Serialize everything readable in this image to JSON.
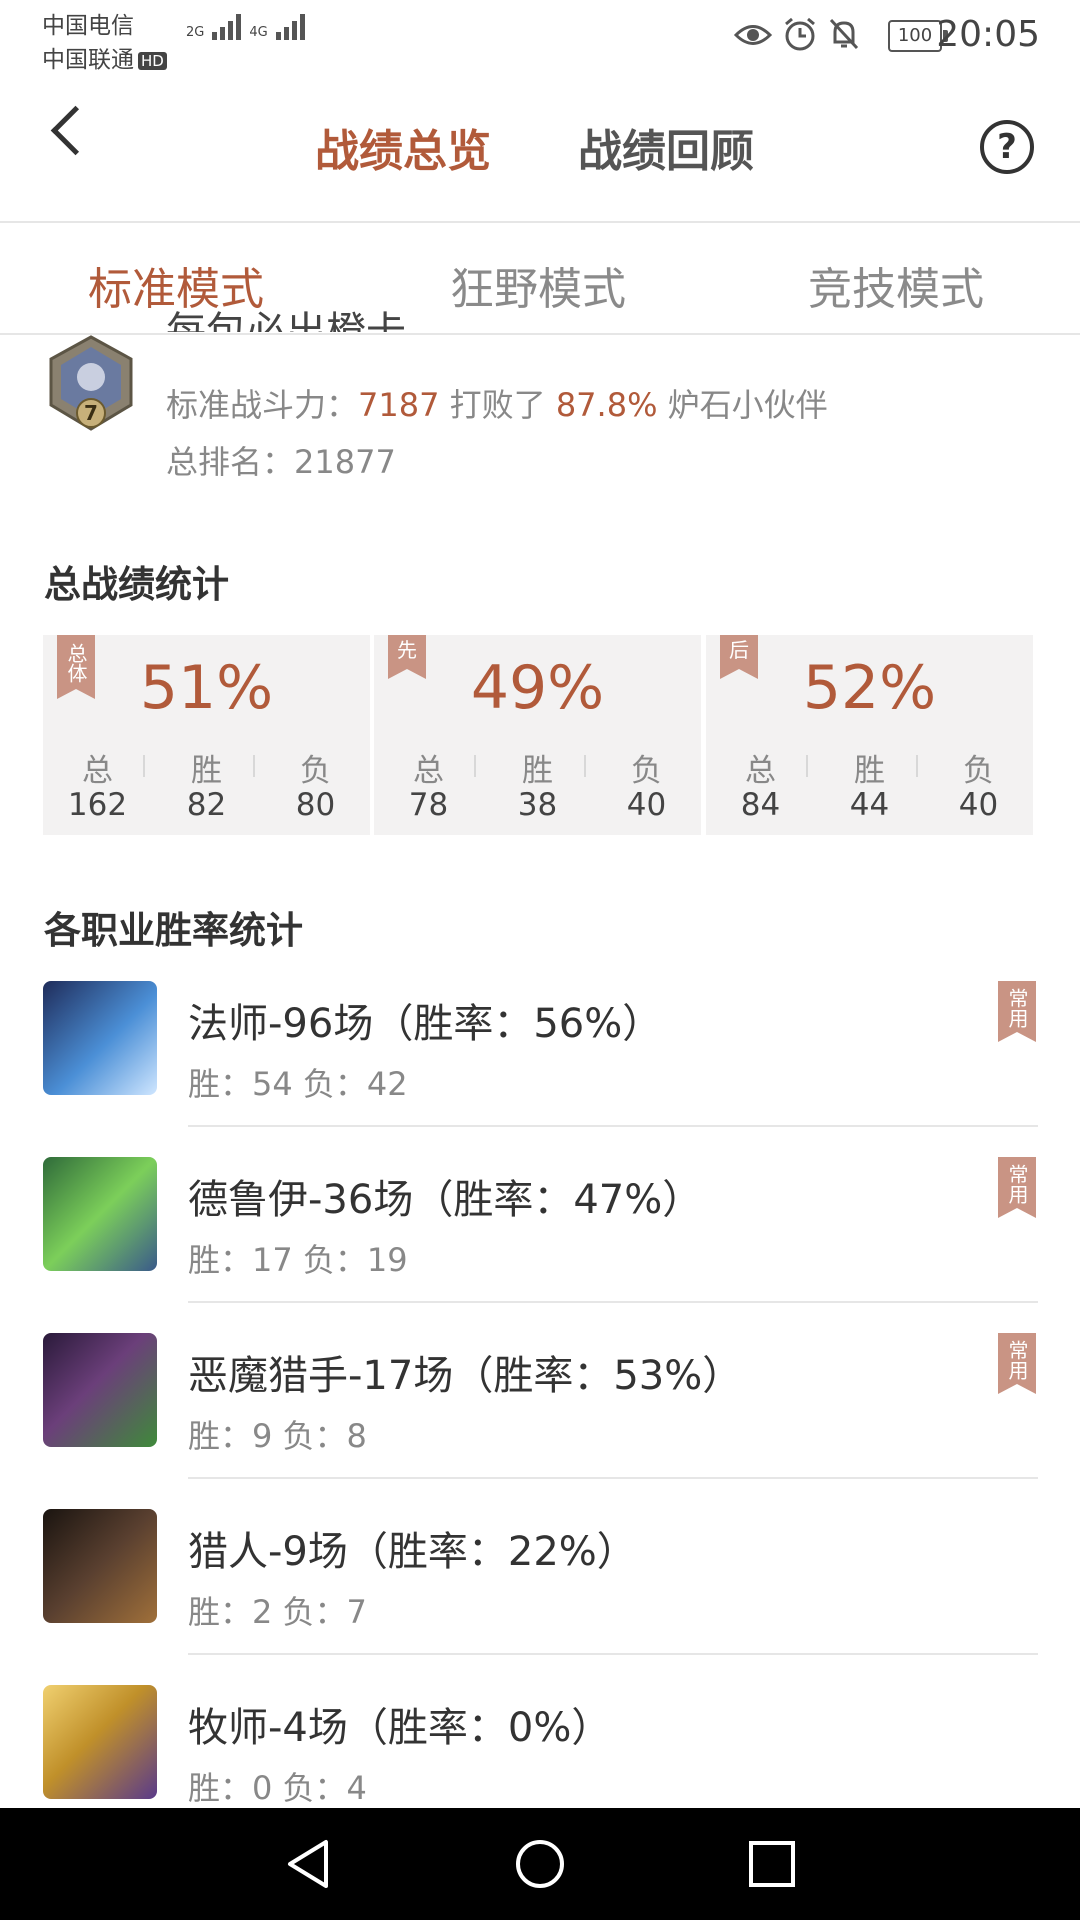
{
  "status_bar": {
    "carrier1": "中国电信",
    "carrier2": "中国联通",
    "hd": "HD",
    "net1": "2G",
    "net2": "4G",
    "battery": "100",
    "time": "20:05"
  },
  "header": {
    "tabs": [
      {
        "label": "战绩总览",
        "active": true
      },
      {
        "label": "战绩回顾",
        "active": false
      }
    ],
    "help": "?"
  },
  "modes": [
    {
      "label": "标准模式",
      "active": true
    },
    {
      "label": "狂野模式",
      "active": false
    },
    {
      "label": "竞技模式",
      "active": false
    }
  ],
  "profile": {
    "name_fragment": "每包必出橙卡",
    "rank_level": "7",
    "power_label": "标准战斗力：",
    "power_value": "7187",
    "beat_label": " 打败了 ",
    "beat_pct": "87.8%",
    "beat_suffix": " 炉石小伙伴",
    "rank_label": "总排名：",
    "rank_value": "21877"
  },
  "summary": {
    "title": "总战绩统计",
    "cards": [
      {
        "tag": "总体",
        "pct": "51%",
        "total_label": "总",
        "win_label": "胜",
        "loss_label": "负",
        "total": "162",
        "win": "82",
        "loss": "80"
      },
      {
        "tag": "先",
        "pct": "49%",
        "total_label": "总",
        "win_label": "胜",
        "loss_label": "负",
        "total": "78",
        "win": "38",
        "loss": "40"
      },
      {
        "tag": "后",
        "pct": "52%",
        "total_label": "总",
        "win_label": "胜",
        "loss_label": "负",
        "total": "84",
        "win": "44",
        "loss": "40"
      }
    ]
  },
  "classes": {
    "title": "各职业胜率统计",
    "items": [
      {
        "name": "法师-96场（胜率：56%）",
        "record": "胜：54  负：42",
        "tag": "常用",
        "avatar_color": "#3b6fb5"
      },
      {
        "name": "德鲁伊-36场（胜率：47%）",
        "record": "胜：17  负：19",
        "tag": "常用",
        "avatar_color": "#4a8a3a"
      },
      {
        "name": "恶魔猎手-17场（胜率：53%）",
        "record": "胜：9  负：8",
        "tag": "常用",
        "avatar_color": "#5a3a6a"
      },
      {
        "name": "猎人-9场（胜率：22%）",
        "record": "胜：2  负：7",
        "tag": "",
        "avatar_color": "#4a3a2a"
      },
      {
        "name": "牧师-4场（胜率：0%）",
        "record": "胜：0  负：4",
        "tag": "",
        "avatar_color": "#b89a3a"
      }
    ]
  }
}
